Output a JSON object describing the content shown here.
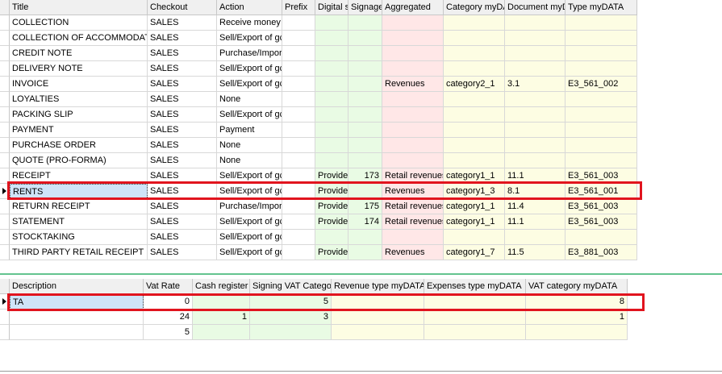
{
  "docs_grid": {
    "columns": [
      "Title",
      "Checkout",
      "Action",
      "Prefix",
      "Digital s",
      "Signage",
      "Aggregated",
      "Category myDA",
      "Document myD",
      "Type myDATA"
    ],
    "rows": [
      [
        "COLLECTION",
        "SALES",
        "Receive money",
        "",
        "",
        "",
        "",
        "",
        "",
        ""
      ],
      [
        "COLLECTION OF ACCOMMODATIO",
        "SALES",
        "Sell/Export of gc",
        "",
        "",
        "",
        "",
        "",
        "",
        ""
      ],
      [
        "CREDIT NOTE",
        "SALES",
        "Purchase/Import",
        "",
        "",
        "",
        "",
        "",
        "",
        ""
      ],
      [
        "DELIVERY NOTE",
        "SALES",
        "Sell/Export of gc",
        "",
        "",
        "",
        "",
        "",
        "",
        ""
      ],
      [
        "INVOICE",
        "SALES",
        "Sell/Export of gc",
        "",
        "",
        "",
        "Revenues",
        "category2_1",
        "3.1",
        "E3_561_002"
      ],
      [
        "LOYALTIES",
        "SALES",
        "None",
        "",
        "",
        "",
        "",
        "",
        "",
        ""
      ],
      [
        "PACKING SLIP",
        "SALES",
        "Sell/Export of gc",
        "",
        "",
        "",
        "",
        "",
        "",
        ""
      ],
      [
        "PAYMENT",
        "SALES",
        "Payment",
        "",
        "",
        "",
        "",
        "",
        "",
        ""
      ],
      [
        "PURCHASE ORDER",
        "SALES",
        "None",
        "",
        "",
        "",
        "",
        "",
        "",
        ""
      ],
      [
        "QUOTE (PRO-FORMA)",
        "SALES",
        "None",
        "",
        "",
        "",
        "",
        "",
        "",
        ""
      ],
      [
        "RECEIPT",
        "SALES",
        "Sell/Export of gc",
        "",
        "Provide",
        "173",
        "Retail revenues",
        "category1_1",
        "11.1",
        "E3_561_003"
      ],
      [
        "RENTS",
        "SALES",
        "Sell/Export of gc",
        "",
        "Provide",
        "",
        "Revenues",
        "category1_3",
        "8.1",
        "E3_561_001"
      ],
      [
        "RETURN RECEIPT",
        "SALES",
        "Purchase/Import",
        "",
        "Provide",
        "175",
        "Retail revenues",
        "category1_1",
        "11.4",
        "E3_561_003"
      ],
      [
        "STATEMENT",
        "SALES",
        "Sell/Export of gc",
        "",
        "Provide",
        "174",
        "Retail revenues",
        "category1_1",
        "11.1",
        "E3_561_003"
      ],
      [
        "STOCKTAKING",
        "SALES",
        "Sell/Export of gc",
        "",
        "",
        "",
        "",
        "",
        "",
        ""
      ],
      [
        "THIRD PARTY RETAIL RECEIPT",
        "SALES",
        "Sell/Export of gc",
        "",
        "Provide",
        "",
        "Revenues",
        "category1_7",
        "11.5",
        "E3_881_003"
      ]
    ]
  },
  "vat_grid": {
    "columns": [
      "Description",
      "Vat Rate",
      "Cash register",
      "Signing VAT Catego",
      "Revenue type myDATA",
      "Expenses type myDATA",
      "VAT category myDATA"
    ],
    "rows": [
      [
        "TA",
        "0",
        "",
        "5",
        "",
        "",
        "8"
      ],
      [
        "",
        "24",
        "1",
        "3",
        "",
        "",
        "1"
      ],
      [
        "",
        "5",
        "",
        "",
        "",
        "",
        ""
      ]
    ]
  },
  "colors": {
    "highlight": "#e1141e",
    "splitter": "#63c38f"
  }
}
